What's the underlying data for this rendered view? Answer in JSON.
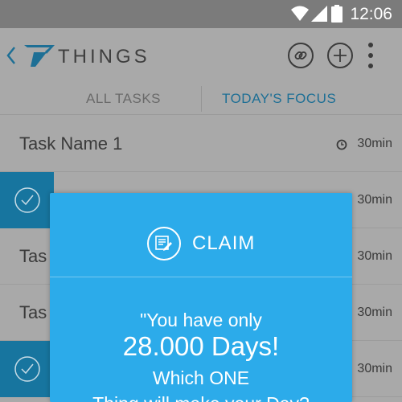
{
  "statusbar": {
    "time": "12:06",
    "icons": [
      "wifi-icon",
      "signal-icon",
      "battery-icon"
    ]
  },
  "appbar": {
    "brand": "THINGS",
    "icons": [
      "back-chevron-icon",
      "seven-logo-icon",
      "link-icon",
      "add-icon",
      "more-vertical-icon"
    ]
  },
  "tabs": [
    {
      "label": "ALL TASKS",
      "active": false
    },
    {
      "label": "TODAY'S FOCUS",
      "active": true
    }
  ],
  "tasks": [
    {
      "name": "Task Name 1",
      "duration": "30min",
      "checked": false
    },
    {
      "name": "",
      "duration": "30min",
      "checked": true
    },
    {
      "name": "Tas",
      "duration": "30min",
      "checked": false
    },
    {
      "name": "Tas",
      "duration": "30min",
      "checked": false
    },
    {
      "name": "",
      "duration": "30min",
      "checked": true
    }
  ],
  "modal": {
    "title": "CLAIM",
    "icon": "note-edit-icon",
    "lines": [
      "\"You have only",
      "28.000 Days!",
      "Which ONE",
      "Thing will make your Day?"
    ]
  },
  "colors": {
    "accent": "#2cabea",
    "checked_bg": "#17759f",
    "active_tab": "#1e6f95",
    "background": "#a9a9a9",
    "statusbar": "#7b7b7b"
  }
}
